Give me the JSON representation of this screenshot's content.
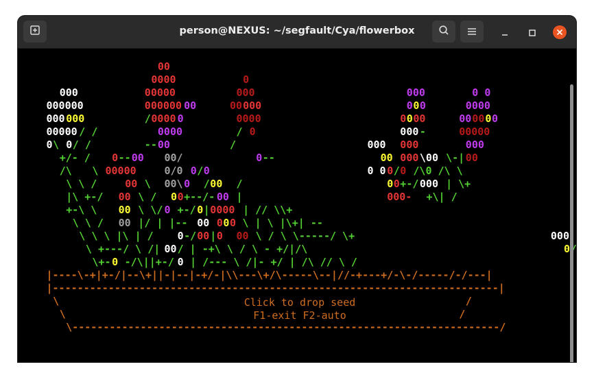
{
  "window": {
    "title": "person@NEXUS: ~/segfault/Cya/flowerbox"
  },
  "icons": {
    "new_tab": "new-tab-icon",
    "search": "search-icon",
    "menu": "hamburger-menu-icon",
    "minimize": "minimize-icon",
    "maximize": "maximize-icon",
    "close": "close-icon"
  },
  "colors": {
    "green": "#55d233",
    "white": "#ffffff",
    "yellow": "#ffff33",
    "red": "#e53535",
    "darkred": "#b81a1a",
    "magenta": "#c03cf0",
    "purple": "#9a1aa8",
    "orange": "#cf6d1f",
    "gray": "#a0a0a0"
  },
  "terminal": {
    "rows": [
      [
        [
          18,
          "r",
          "00"
        ],
        [
          96,
          "m",
          "0000"
        ]
      ],
      [
        [
          17,
          "r",
          "0000"
        ],
        [
          31,
          "dr",
          "0"
        ],
        [
          96,
          "m",
          "00000"
        ]
      ],
      [
        [
          3,
          "w",
          "000"
        ],
        [
          16,
          "r",
          "00000"
        ],
        [
          30,
          "dr",
          "000"
        ],
        [
          56,
          "m",
          "000"
        ],
        [
          66,
          "m",
          "0 0"
        ],
        [
          96,
          "m",
          "00"
        ],
        [
          98,
          "y",
          "0"
        ],
        [
          99,
          "m",
          "00"
        ]
      ],
      [
        [
          1,
          "w",
          "000000"
        ],
        [
          16,
          "r",
          "000000"
        ],
        [
          22,
          "m",
          "00"
        ],
        [
          29,
          "dr",
          "00"
        ],
        [
          31,
          "r",
          "000"
        ],
        [
          56,
          "m",
          "0"
        ],
        [
          57,
          "y",
          "0"
        ],
        [
          58,
          "m",
          "0"
        ],
        [
          65,
          "m",
          "0000"
        ],
        [
          94,
          "g",
          "---"
        ],
        [
          97,
          "m",
          "0000"
        ]
      ],
      [
        [
          1,
          "w",
          "000"
        ],
        [
          4,
          "y",
          "000"
        ],
        [
          16,
          "g",
          "/"
        ],
        [
          17,
          "r",
          "0000"
        ],
        [
          21,
          "m",
          "0"
        ],
        [
          30,
          "dr",
          "0000"
        ],
        [
          55,
          "r",
          "0"
        ],
        [
          56,
          "y",
          "0"
        ],
        [
          57,
          "r",
          "00"
        ],
        [
          64,
          "m",
          "00"
        ],
        [
          66,
          "dr",
          "00"
        ],
        [
          68,
          "y",
          "0"
        ],
        [
          69,
          "m",
          "0"
        ],
        [
          95,
          "g",
          "/"
        ],
        [
          96,
          "m",
          "0000"
        ]
      ],
      [
        [
          1,
          "w",
          "00000"
        ],
        [
          6,
          "g",
          "/   /"
        ],
        [
          18,
          "m",
          "0000"
        ],
        [
          30,
          "g",
          "/"
        ],
        [
          32,
          "dr",
          "0"
        ],
        [
          55,
          "w",
          "000"
        ],
        [
          58,
          "g",
          "-"
        ],
        [
          64,
          "dr",
          "00000"
        ],
        [
          95,
          "g",
          "+-/"
        ]
      ],
      [
        [
          1,
          "w",
          "0"
        ],
        [
          2,
          "g",
          "\\ "
        ],
        [
          4,
          "w",
          "0"
        ],
        [
          5,
          "g",
          "/    /"
        ],
        [
          16,
          "g",
          "--"
        ],
        [
          18,
          "m",
          "00"
        ],
        [
          29,
          "g",
          "/"
        ],
        [
          50,
          "w",
          "000"
        ],
        [
          55,
          "r",
          "000"
        ],
        [
          65,
          "m",
          "000"
        ],
        [
          95,
          "g",
          "|"
        ],
        [
          100,
          "m",
          "000"
        ]
      ],
      [
        [
          3,
          "g",
          "+/-  /"
        ],
        [
          11,
          "r",
          "0"
        ],
        [
          12,
          "g",
          "--"
        ],
        [
          14,
          "m",
          "00"
        ],
        [
          19,
          "gy",
          "00/"
        ],
        [
          33,
          "m",
          "0"
        ],
        [
          34,
          "g",
          "--"
        ],
        [
          52,
          "y",
          "00"
        ],
        [
          55,
          "r",
          "000"
        ],
        [
          58,
          "w",
          "\\00"
        ],
        [
          62,
          "g",
          "\\-|"
        ],
        [
          65,
          "dr",
          "00"
        ],
        [
          94,
          "g",
          "/"
        ],
        [
          101,
          "y",
          "0"
        ],
        [
          102,
          "m",
          "0"
        ]
      ],
      [
        [
          3,
          "g",
          "/\\"
        ],
        [
          8,
          "g",
          "\\ "
        ],
        [
          10,
          "r",
          "00000"
        ],
        [
          19,
          "gy",
          "0/0"
        ],
        [
          23,
          "m",
          "0"
        ],
        [
          24,
          "g",
          "/"
        ],
        [
          25,
          "m",
          "0"
        ],
        [
          50,
          "w",
          "0 0"
        ],
        [
          53,
          "r",
          "0"
        ],
        [
          54,
          "g",
          "/"
        ],
        [
          55,
          "dr",
          "0"
        ],
        [
          57,
          "g",
          "/\\0  /\\ \\"
        ],
        [
          94,
          "g",
          "+---  --"
        ],
        [
          102,
          "m",
          "0"
        ]
      ],
      [
        [
          4,
          "g",
          "\\    \\ /"
        ],
        [
          13,
          "r",
          "00"
        ],
        [
          16,
          "g",
          "\\"
        ],
        [
          19,
          "gy",
          "00\\"
        ],
        [
          22,
          "m",
          "0"
        ],
        [
          25,
          "g",
          "/"
        ],
        [
          26,
          "y",
          "00"
        ],
        [
          30,
          "g",
          "/"
        ],
        [
          53,
          "y",
          "0"
        ],
        [
          54,
          "r",
          "0"
        ],
        [
          55,
          "g",
          "+-/"
        ],
        [
          58,
          "w",
          "000"
        ],
        [
          62,
          "g",
          "| \\+"
        ],
        [
          94,
          "g",
          "|     +/"
        ]
      ],
      [
        [
          4,
          "g",
          "|\\   +-/"
        ],
        [
          12,
          "r",
          "00"
        ],
        [
          15,
          "g",
          "\\ / "
        ],
        [
          20,
          "y",
          "0"
        ],
        [
          21,
          "r",
          "0"
        ],
        [
          22,
          "g",
          "+--/-"
        ],
        [
          27,
          "m",
          "00"
        ],
        [
          30,
          "g",
          "|"
        ],
        [
          53,
          "r",
          "000-"
        ],
        [
          59,
          "g",
          "+\\| /"
        ],
        [
          86,
          "m",
          "00"
        ],
        [
          89,
          "g",
          "/     \\"
        ]
      ],
      [
        [
          4,
          "g",
          "+-\\  \\ "
        ],
        [
          12,
          "y",
          "00"
        ],
        [
          15,
          "g",
          "\\ \\/"
        ],
        [
          19,
          "m",
          "0"
        ],
        [
          21,
          "g",
          "+-/"
        ],
        [
          24,
          "y",
          "0"
        ],
        [
          25,
          "g",
          "|"
        ],
        [
          26,
          "r",
          "0000"
        ],
        [
          31,
          "g",
          "|    //     \\\\+"
        ],
        [
          89,
          "g",
          "\\+//     \\"
        ]
      ],
      [
        [
          5,
          "g",
          "\\ \\ /   "
        ],
        [
          12,
          "gy",
          "00"
        ],
        [
          15,
          "g",
          "|/ |  |--"
        ],
        [
          24,
          "w",
          "00"
        ],
        [
          27,
          "r",
          "0"
        ],
        [
          28,
          "y",
          "0"
        ],
        [
          29,
          "r",
          "0"
        ],
        [
          30,
          "g",
          " \\   | \\     |\\+|     -- "
        ],
        [
          84,
          "m",
          "0"
        ],
        [
          85,
          "g",
          "+-/       -+"
        ]
      ],
      [
        [
          6,
          "g",
          "\\ \\ \\  |\\   | / "
        ],
        [
          21,
          "w",
          "0"
        ],
        [
          22,
          "g",
          "-/ "
        ],
        [
          24,
          "r",
          "00"
        ],
        [
          26,
          "g",
          "|"
        ],
        [
          27,
          "r",
          "0"
        ],
        [
          28,
          "g",
          " "
        ],
        [
          30,
          "dr",
          "00"
        ],
        [
          32,
          "g",
          "  \\ /   \\    \\-----/    \\+"
        ],
        [
          78,
          "w",
          "000"
        ],
        [
          84,
          "g",
          "   "
        ],
        [
          88,
          "m",
          "00"
        ],
        [
          91,
          "g",
          "/"
        ]
      ],
      [
        [
          7,
          "g",
          "\\ +---/ \\ /|"
        ],
        [
          19,
          "w",
          "00"
        ],
        [
          21,
          "g",
          "/ |  -+\\   \\   /     \\ - +/|/\\   "
        ],
        [
          80,
          "y",
          "0"
        ],
        [
          81,
          "g",
          "//"
        ],
        [
          84,
          "w",
          "00"
        ],
        [
          92,
          "y",
          "00"
        ],
        [
          94,
          "g",
          "/"
        ]
      ],
      [
        [
          8,
          "g",
          "\\+-"
        ],
        [
          11,
          "y",
          "0"
        ],
        [
          12,
          "g",
          " -/\\||+-/"
        ],
        [
          21,
          "w",
          "0"
        ],
        [
          22,
          "g",
          " |  /---   \\ /|-   +/  | /\\    //   \\     /"
        ],
        [
          91,
          "m",
          "00"
        ]
      ],
      [
        [
          1,
          "o",
          "|----\\-+|+-/|--\\+||-|--|-+/-|\\\\---\\+/\\-----\\--|//-+---+/-\\-/-----/-/---|"
        ]
      ],
      [
        [
          1,
          "o",
          "|------------------------------------------------------------------------|"
        ]
      ],
      [
        [
          2,
          "o",
          "\\"
        ],
        [
          65,
          "o",
          "/"
        ]
      ],
      [
        [
          3,
          "o",
          "\\"
        ],
        [
          64,
          "o",
          "/"
        ]
      ],
      [
        [
          4,
          "o",
          "\\---------------------------------------------------------------------/"
        ]
      ]
    ],
    "prompt_line1": "Click to drop seed",
    "prompt_line2": "F1-exit  F2-auto"
  }
}
